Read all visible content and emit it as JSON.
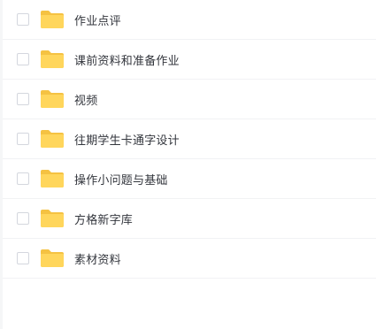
{
  "files": [
    {
      "name": "作业点评",
      "icon": "folder-icon"
    },
    {
      "name": "课前资料和准备作业",
      "icon": "folder-icon"
    },
    {
      "name": "视频",
      "icon": "folder-icon"
    },
    {
      "name": "往期学生卡通字设计",
      "icon": "folder-icon"
    },
    {
      "name": "操作小问题与基础",
      "icon": "folder-icon"
    },
    {
      "name": "方格新字库",
      "icon": "folder-icon"
    },
    {
      "name": "素材资料",
      "icon": "folder-icon"
    }
  ],
  "colors": {
    "folder_body": "#ffd65c",
    "folder_tab": "#f5c242",
    "text": "#33363d",
    "divider": "#f1f2f4",
    "checkbox_border": "#d4d7de"
  }
}
